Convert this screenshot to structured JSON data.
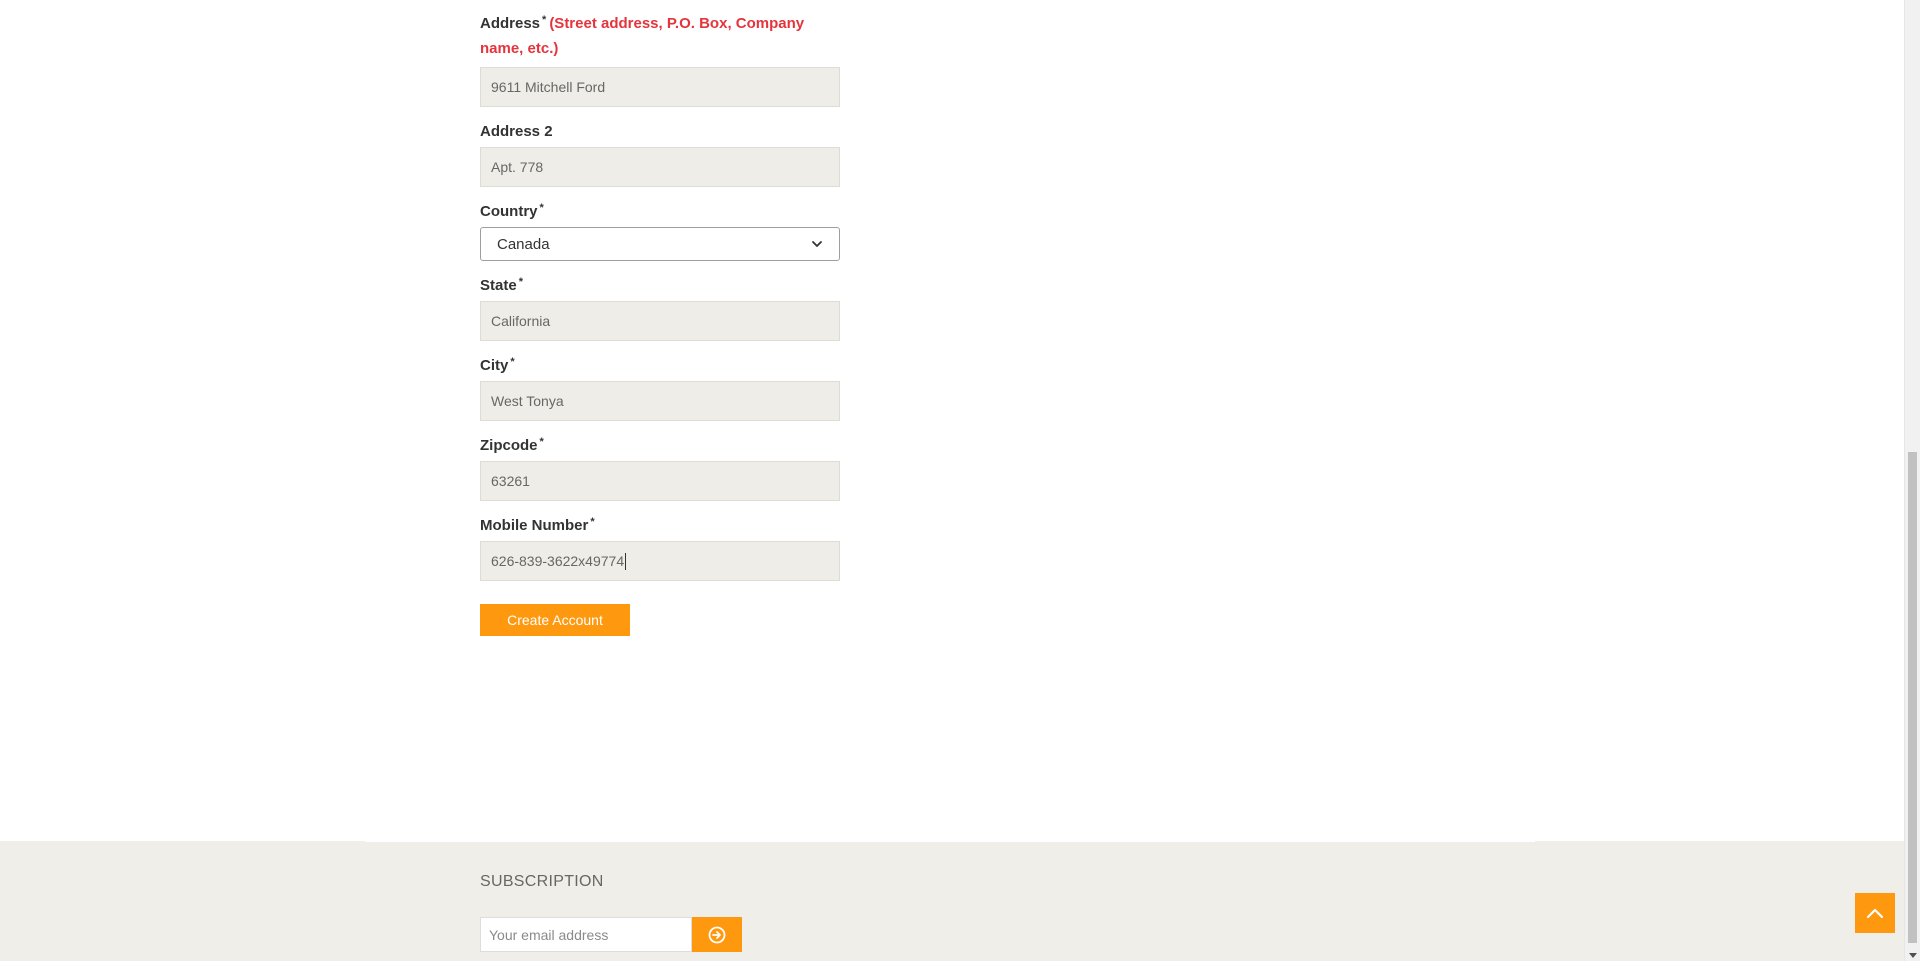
{
  "form": {
    "address": {
      "label": "Address",
      "required_mark": "*",
      "hint": "(Street address, P.O. Box, Company name, etc.)",
      "value": "9611 Mitchell Ford"
    },
    "address2": {
      "label": "Address 2",
      "value": "Apt. 778"
    },
    "country": {
      "label": "Country",
      "required_mark": "*",
      "selected": "Canada"
    },
    "state": {
      "label": "State",
      "required_mark": "*",
      "value": "California"
    },
    "city": {
      "label": "City",
      "required_mark": "*",
      "value": "West Tonya"
    },
    "zipcode": {
      "label": "Zipcode",
      "required_mark": "*",
      "value": "63261"
    },
    "mobile": {
      "label": "Mobile Number",
      "required_mark": "*",
      "value": "626-839-3622x49774"
    },
    "submit_label": "Create Account"
  },
  "footer": {
    "subscription_title": "SUBSCRIPTION",
    "email_placeholder": "Your email address"
  },
  "colors": {
    "accent": "#fe980f",
    "hint_red": "#e4343c",
    "input_bg": "#eeede8",
    "footer_bg": "#efeee9"
  },
  "icons": {
    "subscribe": "arrow-circle-right-icon",
    "scroll_top": "chevron-up-icon",
    "select_dropdown": "chevron-down-icon"
  }
}
